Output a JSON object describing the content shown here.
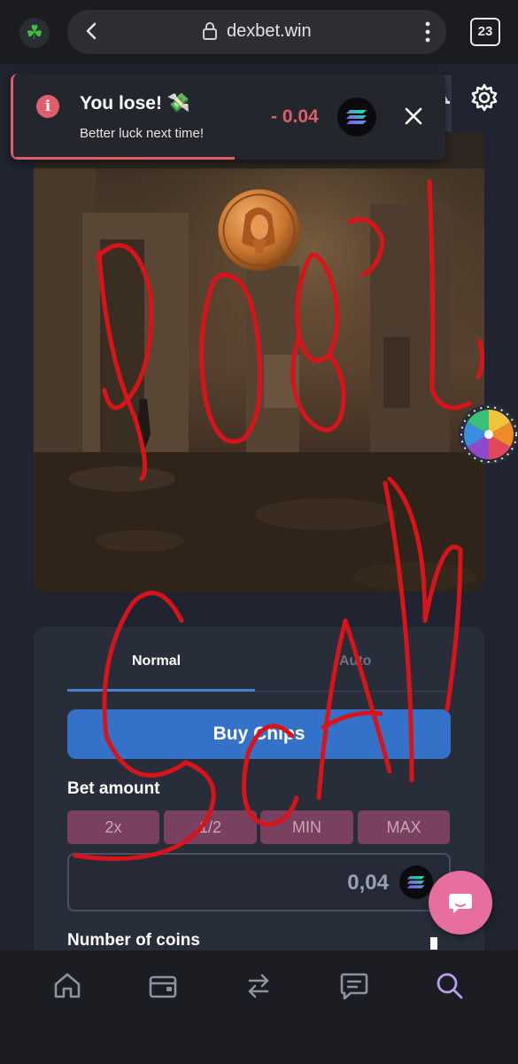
{
  "browser": {
    "url": "dexbet.win",
    "tab_count": "23",
    "icons": [
      "clover-icon",
      "back-chevron-icon",
      "lock-icon",
      "kebab-menu-icon"
    ]
  },
  "header": {
    "icons": [
      "bell-icon",
      "gear-icon"
    ]
  },
  "toast": {
    "title": "You lose! 💸",
    "message": "Better luck next time!",
    "amount": "- 0.04",
    "currency_icon": "solana-icon",
    "accent_color": "#e05d6c"
  },
  "game": {
    "scene": "egyptian-temple",
    "coin_icon": "pharaoh-coin-icon",
    "side_widget_icon": "fortune-wheel-icon"
  },
  "bet_panel": {
    "tabs": [
      {
        "label": "Normal",
        "active": true
      },
      {
        "label": "Auto",
        "active": false
      }
    ],
    "buy_chips_label": "Buy Chips",
    "bet_amount_label": "Bet amount",
    "multipliers": [
      "2x",
      "1/2",
      "MIN",
      "MAX"
    ],
    "bet_value": "0,04",
    "number_of_coins_label": "Number of coins",
    "accent_color": "#3471c9"
  },
  "chat": {
    "icon": "chat-bubble-icon",
    "color": "#e86ea0"
  },
  "bottom_nav": {
    "items": [
      {
        "icon": "home-icon",
        "active": false
      },
      {
        "icon": "wallet-icon",
        "active": false
      },
      {
        "icon": "swap-icon",
        "active": false
      },
      {
        "icon": "chat-list-icon",
        "active": false
      },
      {
        "icon": "search-icon",
        "active": true
      }
    ]
  },
  "overlay": {
    "scribble_color": "#d8141a"
  }
}
